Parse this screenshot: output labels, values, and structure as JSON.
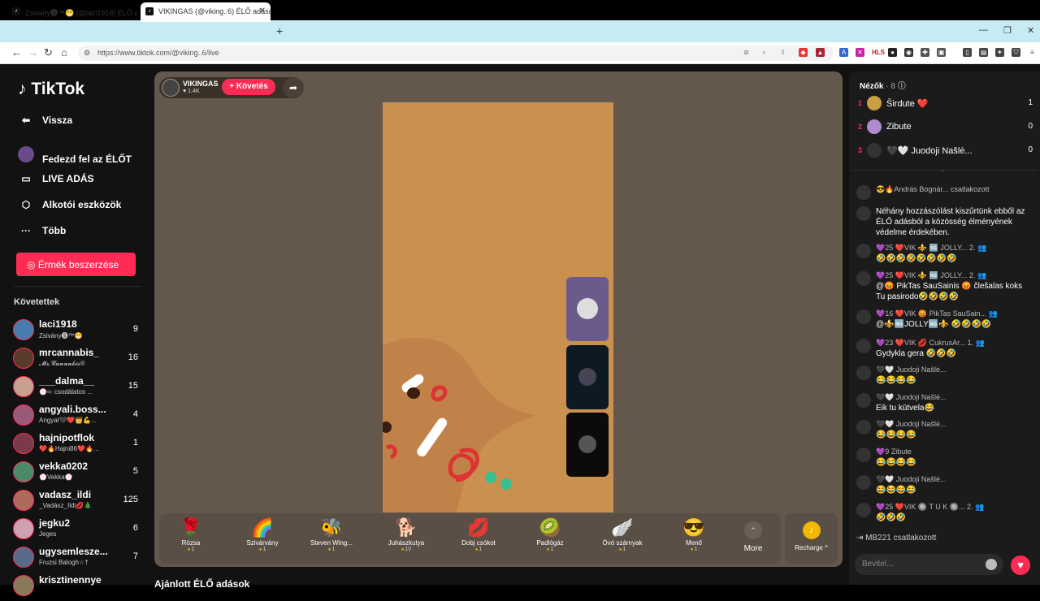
{
  "browser": {
    "tabs": [
      {
        "title": "Zsivány🅢™😁 (@laci1918) ÉLŐ adása"
      },
      {
        "title": "VIKINGAS (@viking..6) ÉLŐ adása"
      }
    ],
    "url": "https://www.tiktok.com/@viking..6/live"
  },
  "sidebar": {
    "logo": "TikTok",
    "back": "Vissza",
    "items": [
      {
        "label": "Fedezd fel az ÉLŐT"
      },
      {
        "label": "LIVE ADÁS"
      },
      {
        "label": "Alkotói eszközök"
      },
      {
        "label": "Több"
      }
    ],
    "coins_button": "Érmék beszerzése",
    "following_header": "Követettek",
    "following": [
      {
        "name": "laci1918",
        "sub": "Zsivány🅢™😁",
        "count": "9",
        "color": "#4a7bb0"
      },
      {
        "name": "mrcannabis_",
        "sub": "𝓜𝓻.𝓒𝓪𝓷𝓷𝓪𝓫𝓲𝓼®",
        "count": "16",
        "color": "#5a3a2a"
      },
      {
        "name": "___dalma__",
        "sub": "💮➪ csodálatos ...",
        "count": "15",
        "color": "#c8a090"
      },
      {
        "name": "angyali.boss...",
        "sub": "Angyal🖤❤️👑💪...",
        "count": "4",
        "color": "#9a5a7a"
      },
      {
        "name": "hajnipotflok",
        "sub": "❤️🔥Hajni86❤️🔥...",
        "count": "1",
        "color": "#7a3a4a"
      },
      {
        "name": "vekka0202",
        "sub": "💮Vekka💮",
        "count": "5",
        "color": "#4a8a6a"
      },
      {
        "name": "vadasz_ildi",
        "sub": "_Vadász_Ildi💋🎄",
        "count": "125",
        "color": "#b06a5a"
      },
      {
        "name": "jegku2",
        "sub": "Jeges",
        "count": "6",
        "color": "#d0a0b0"
      },
      {
        "name": "ugysemlesze...",
        "sub": "Fruzsi Balogh☆†",
        "count": "7",
        "color": "#5a6a8a"
      },
      {
        "name": "krisztinennye",
        "sub": "",
        "count": "",
        "color": "#8a7a5a"
      }
    ]
  },
  "live": {
    "host_name": "VIKINGAS",
    "host_likes": "♥ 1.4K",
    "follow_button": "+ Követés",
    "gifts": [
      {
        "icon": "🌹",
        "name": "Rózsa",
        "price": "1"
      },
      {
        "icon": "🌈",
        "name": "Szivárvány",
        "price": "1"
      },
      {
        "icon": "🐝",
        "name": "Steven Wing...",
        "price": "1"
      },
      {
        "icon": "🐕",
        "name": "Juhászkutya",
        "price": "10"
      },
      {
        "icon": "💋",
        "name": "Dobj csókot",
        "price": "1"
      },
      {
        "icon": "🥝",
        "name": "Padlógáz",
        "price": "1"
      },
      {
        "icon": "🪽",
        "name": "Óvó szárnyak",
        "price": "1"
      },
      {
        "icon": "😎",
        "name": "Menő",
        "price": "1"
      }
    ],
    "more_label": "More",
    "recharge_label": "Recharge ^",
    "below_title": "Ajánlott ÉLŐ adások"
  },
  "chat": {
    "viewers_label": "Nézők",
    "viewers_count": "· 8",
    "top_viewers": [
      {
        "rank": "1",
        "name": "Širdute ❤️",
        "score": "1",
        "color": "#c9a040"
      },
      {
        "rank": "2",
        "name": "Zibute",
        "score": "0",
        "color": "#b08ad0"
      },
      {
        "rank": "3",
        "name": "🖤🤍 Juodoji Našlė...",
        "score": "0",
        "color": "#333"
      }
    ],
    "messages": [
      {
        "header": "😎🔥András Bognár...   csatlakozott",
        "text": ""
      },
      {
        "header": "",
        "text": "Néhány hozzászólást kiszűrtünk ebből az ÉLŐ adásból a közösség élményének védelme érdekében."
      },
      {
        "header": "💜25 ❤️VIK ⚜️ 🆖 JOLLY...  2. 👥",
        "text": "🤣🤣🤣🤣🤣🤣🤣🤣"
      },
      {
        "header": "💜25 ❤️VIK ⚜️ 🆖 JOLLY...  2. 👥",
        "text": "@😡 PikTas SauSainis 😡 člešalas koks Tu pasirodo🤣🤣🤣🤣"
      },
      {
        "header": "💜16 ❤️VIK 😡 PikTas SauSain... 👥",
        "text": "@⚜️🆖JOLLY🆖⚜️ 🤣🤣🤣🤣"
      },
      {
        "header": "💜23 ❤️VIK 💋 CukrusAr...  1. 👥",
        "text": "Gydykla gera 🤣🤣🤣"
      },
      {
        "header": "🖤🤍 Juodoji Našlė...",
        "text": "😂😂😂😂"
      },
      {
        "header": "🖤🤍 Juodoji Našlė...",
        "text": "Eik tu kūtvela😂"
      },
      {
        "header": "🖤🤍 Juodoji Našlė...",
        "text": "😂😂😂😂"
      },
      {
        "header": "💜9 Zibute",
        "text": "😂😂😂😂"
      },
      {
        "header": "🖤🤍 Juodoji Našlė...",
        "text": "😂😂😂😂"
      },
      {
        "header": "💜25 ❤️VIK 🔘 T U K 🔘...  2. 👥",
        "text": "🤣🤣🤣"
      }
    ],
    "joined_last": "MB221  csatlakozott",
    "input_placeholder": "Bevitel..."
  }
}
